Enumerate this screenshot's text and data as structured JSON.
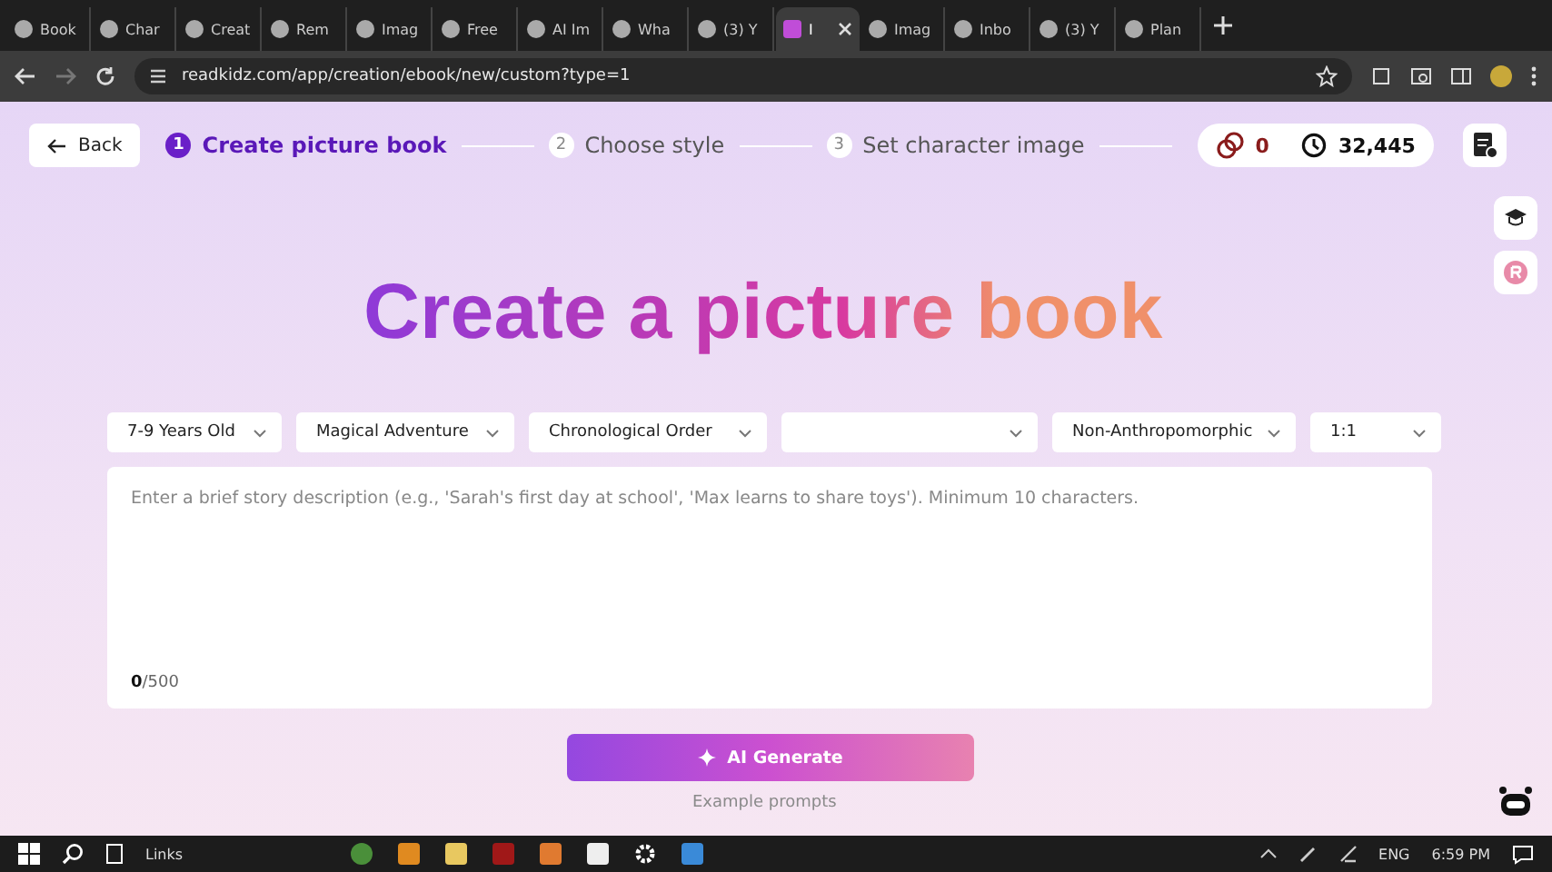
{
  "browser": {
    "tabs": [
      {
        "title": "Book",
        "selected": false
      },
      {
        "title": "Char",
        "selected": false
      },
      {
        "title": "Creat",
        "selected": false
      },
      {
        "title": "Rem",
        "selected": false
      },
      {
        "title": "Imag",
        "selected": false
      },
      {
        "title": "Free",
        "selected": false
      },
      {
        "title": "AI Im",
        "selected": false
      },
      {
        "title": "Wha",
        "selected": false
      },
      {
        "title": "(3) Y",
        "selected": false
      },
      {
        "title": "I",
        "selected": true
      },
      {
        "title": "Imag",
        "selected": false
      },
      {
        "title": "Inbo",
        "selected": false
      },
      {
        "title": "(3) Y",
        "selected": false
      },
      {
        "title": "Plan",
        "selected": false
      }
    ],
    "url": "readkidz.com/app/creation/ebook/new/custom?type=1"
  },
  "header": {
    "back": "Back",
    "steps": [
      {
        "number": "1",
        "label": "Create picture book",
        "selected": true
      },
      {
        "number": "2",
        "label": "Choose style",
        "selected": false
      },
      {
        "number": "3",
        "label": "Set character image",
        "selected": false
      }
    ],
    "coins": "0",
    "credits": "32,445"
  },
  "title": "Create a picture book",
  "dropdowns": [
    {
      "kind": "select",
      "value": "7-9 Years Old"
    },
    {
      "kind": "select",
      "value": "Magical Adventure"
    },
    {
      "kind": "select",
      "value": "Chronological Order"
    },
    {
      "kind": "select"
    },
    {
      "kind": "select",
      "value": "Non-Anthropomorphic"
    },
    {
      "kind": "select",
      "value": "1:1"
    }
  ],
  "story": {
    "placeholder": "Enter a brief story description (e.g., 'Sarah's first day at school', 'Max learns to share toys'). Minimum 10 characters.",
    "counter": "**0**/500"
  },
  "generate": "AI Generate",
  "examples": "Example prompts",
  "taskbar": {
    "links": "Links",
    "language": "ENG",
    "time": "6:59 PM"
  }
}
